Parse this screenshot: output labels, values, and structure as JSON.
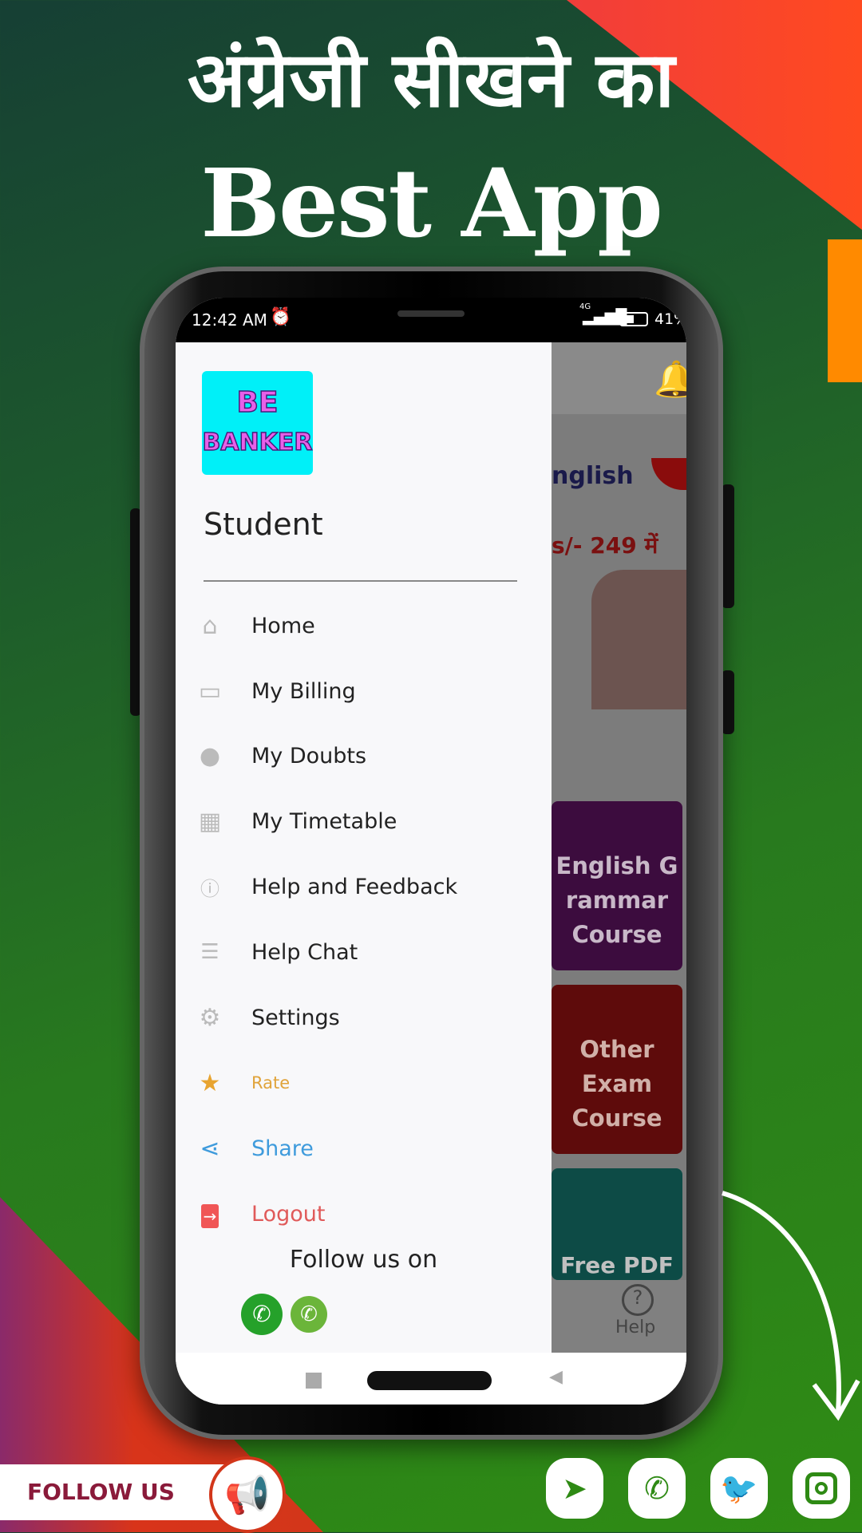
{
  "banner": {
    "title_line1": "अंग्रेजी सीखने का",
    "title_line2": "Best App"
  },
  "status_bar": {
    "time": "12:42 AM",
    "network": "4G",
    "battery": "41%"
  },
  "drawer": {
    "logo_text": "BE BANKER",
    "user_name": "Student",
    "items": [
      {
        "label": "Home",
        "icon": "home-icon",
        "color": "#222222"
      },
      {
        "label": "My Billing",
        "icon": "billing-icon",
        "color": "#222222"
      },
      {
        "label": "My Doubts",
        "icon": "lightbulb-icon",
        "color": "#222222"
      },
      {
        "label": "My Timetable",
        "icon": "timetable-icon",
        "color": "#222222"
      },
      {
        "label": "Help and Feedback",
        "icon": "help-icon",
        "color": "#222222"
      },
      {
        "label": "Help Chat",
        "icon": "chat-icon",
        "color": "#222222"
      },
      {
        "label": "Settings",
        "icon": "gear-icon",
        "color": "#222222"
      },
      {
        "label": "Rate",
        "icon": "star-icon",
        "color": "#e0a33a"
      },
      {
        "label": "Share",
        "icon": "share-icon",
        "color": "#3f9bdc"
      },
      {
        "label": "Logout",
        "icon": "logout-icon",
        "color": "#e05a5a"
      }
    ],
    "follow_label": "Follow us on"
  },
  "background_app": {
    "banner_word": "nglish",
    "price_text": "s/- 249 में",
    "course1": "English G rammar Course",
    "course2": "Other Exam Course",
    "course3": "Free PDF",
    "nav_help": "Help"
  },
  "footer": {
    "follow_us": "FOLLOW US",
    "social": [
      "telegram",
      "whatsapp",
      "twitter",
      "instagram"
    ]
  }
}
